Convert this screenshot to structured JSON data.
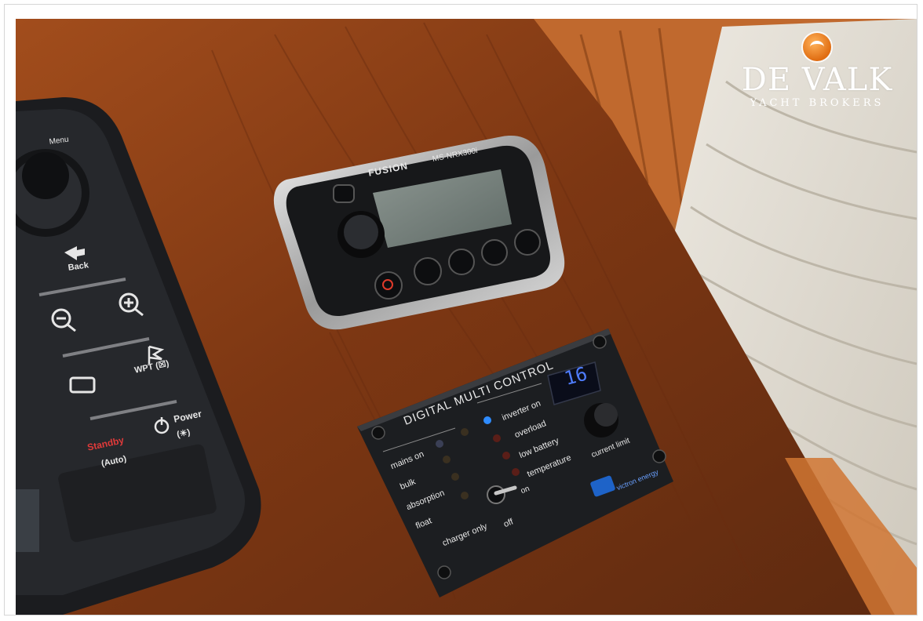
{
  "watermark": {
    "brand": "DE VALK",
    "tagline": "YACHT BROKERS",
    "emblem_icon": "falcon-emblem-icon"
  },
  "photo": {
    "subject": "boat console",
    "colors": {
      "wood": "#8a3f17",
      "device": "#1b1d20",
      "chrome": "#c9c9c9",
      "display": "#1e4fd6"
    }
  },
  "chartplotter": {
    "menu_label": "Menu",
    "back_label": "Back",
    "wpt_label": "WPT (☒)",
    "standby_label": "Standby",
    "auto_label": "(Auto)",
    "power_label": "Power",
    "brightness_label": "(☀)"
  },
  "fusion_radio": {
    "brand": "FUSION",
    "model": "MS-NRX300i"
  },
  "multi_control": {
    "title": "DIGITAL MULTI CONTROL",
    "display_value": "16",
    "left_indicators": [
      "mains on",
      "bulk",
      "absorption",
      "float"
    ],
    "right_indicators": [
      "inverter on",
      "overload",
      "low battery",
      "temperature"
    ],
    "switch_labels": {
      "charger_only": "charger only",
      "off": "off",
      "on": "on"
    },
    "knob_label": "current limit",
    "maker": "victron energy"
  }
}
